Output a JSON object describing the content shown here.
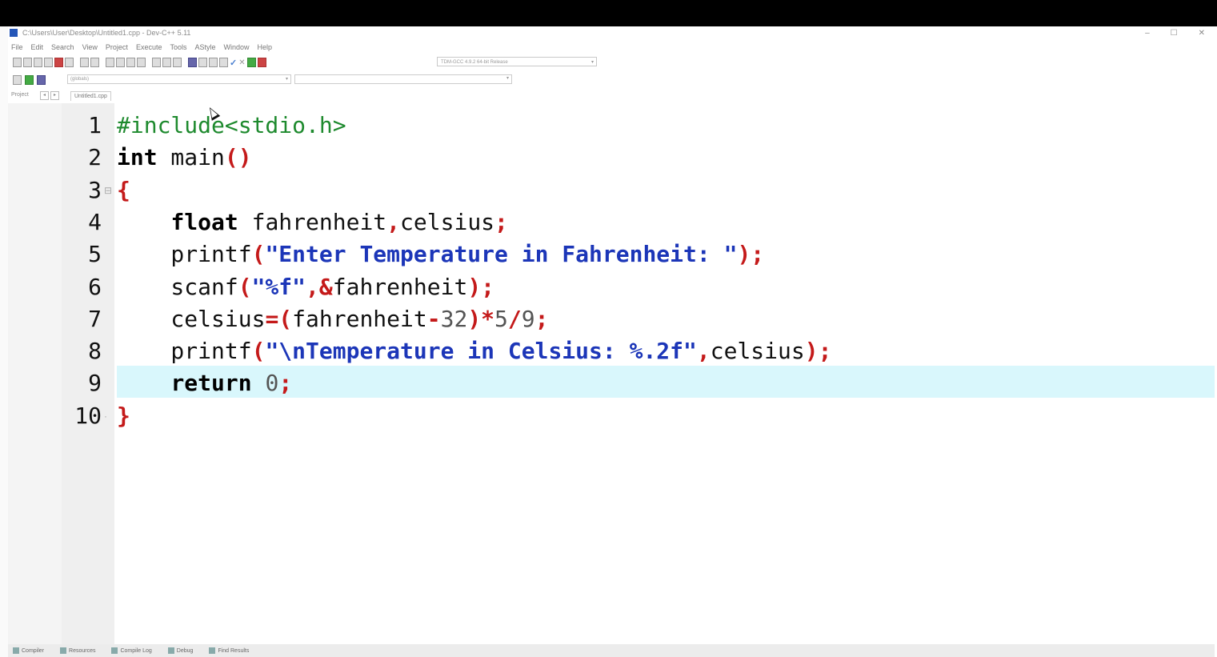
{
  "window": {
    "title": "C:\\Users\\User\\Desktop\\Untitled1.cpp - Dev-C++ 5.11",
    "controls": [
      "–",
      "☐",
      "✕"
    ]
  },
  "menu": [
    "File",
    "Edit",
    "Search",
    "View",
    "Project",
    "Execute",
    "Tools",
    "AStyle",
    "Window",
    "Help"
  ],
  "toolbar": {
    "compiler": "TDM-GCC 4.9.2 64-bit Release",
    "class_select": "(globals)"
  },
  "tabs": {
    "project": "Project",
    "file": "Untitled1.cpp"
  },
  "editor": {
    "lines": [
      {
        "n": "1",
        "fold": "",
        "tokens": [
          {
            "t": "#include<stdio.h>",
            "c": "pre"
          }
        ]
      },
      {
        "n": "2",
        "fold": "",
        "tokens": [
          {
            "t": "int",
            "c": "kw"
          },
          {
            "t": " main",
            "c": "id"
          },
          {
            "t": "()",
            "c": "sym"
          }
        ]
      },
      {
        "n": "3",
        "fold": "⊟",
        "tokens": [
          {
            "t": "{",
            "c": "sym"
          }
        ]
      },
      {
        "n": "4",
        "fold": "",
        "tokens": [
          {
            "t": "    ",
            "c": "id"
          },
          {
            "t": "float",
            "c": "kw"
          },
          {
            "t": " fahrenheit",
            "c": "id"
          },
          {
            "t": ",",
            "c": "sym"
          },
          {
            "t": "celsius",
            "c": "id"
          },
          {
            "t": ";",
            "c": "sym"
          }
        ]
      },
      {
        "n": "5",
        "fold": "",
        "tokens": [
          {
            "t": "    printf",
            "c": "id"
          },
          {
            "t": "(",
            "c": "sym"
          },
          {
            "t": "\"Enter Temperature in Fahrenheit: \"",
            "c": "str"
          },
          {
            "t": ");",
            "c": "sym"
          }
        ]
      },
      {
        "n": "6",
        "fold": "",
        "tokens": [
          {
            "t": "    scanf",
            "c": "id"
          },
          {
            "t": "(",
            "c": "sym"
          },
          {
            "t": "\"%f\"",
            "c": "str"
          },
          {
            "t": ",&",
            "c": "sym"
          },
          {
            "t": "fahrenheit",
            "c": "id"
          },
          {
            "t": ");",
            "c": "sym"
          }
        ]
      },
      {
        "n": "7",
        "fold": "",
        "tokens": [
          {
            "t": "    celsius",
            "c": "id"
          },
          {
            "t": "=(",
            "c": "sym"
          },
          {
            "t": "fahrenheit",
            "c": "id"
          },
          {
            "t": "-",
            "c": "sym"
          },
          {
            "t": "32",
            "c": "num"
          },
          {
            "t": ")*",
            "c": "sym"
          },
          {
            "t": "5",
            "c": "num"
          },
          {
            "t": "/",
            "c": "sym"
          },
          {
            "t": "9",
            "c": "num"
          },
          {
            "t": ";",
            "c": "sym"
          }
        ]
      },
      {
        "n": "8",
        "fold": "",
        "tokens": [
          {
            "t": "    printf",
            "c": "id"
          },
          {
            "t": "(",
            "c": "sym"
          },
          {
            "t": "\"\\nTemperature in Celsius: %.2f\"",
            "c": "str"
          },
          {
            "t": ",",
            "c": "sym"
          },
          {
            "t": "celsius",
            "c": "id"
          },
          {
            "t": ");",
            "c": "sym"
          }
        ]
      },
      {
        "n": "9",
        "fold": "",
        "tokens": [
          {
            "t": "    ",
            "c": "id"
          },
          {
            "t": "return",
            "c": "kw"
          },
          {
            "t": " ",
            "c": "id"
          },
          {
            "t": "0",
            "c": "num"
          },
          {
            "t": ";",
            "c": "sym"
          }
        ]
      },
      {
        "n": "10",
        "fold": "·",
        "tokens": [
          {
            "t": "}",
            "c": "sym"
          }
        ]
      }
    ],
    "active_line": "9"
  },
  "statusbar": [
    "Compiler",
    "Resources",
    "Compile Log",
    "Debug",
    "Find Results"
  ],
  "colors": {
    "preprocessor": "#1e8a2e",
    "symbol": "#c41a1a",
    "string": "#1c36b8",
    "active_line": "#d9f7fc"
  }
}
